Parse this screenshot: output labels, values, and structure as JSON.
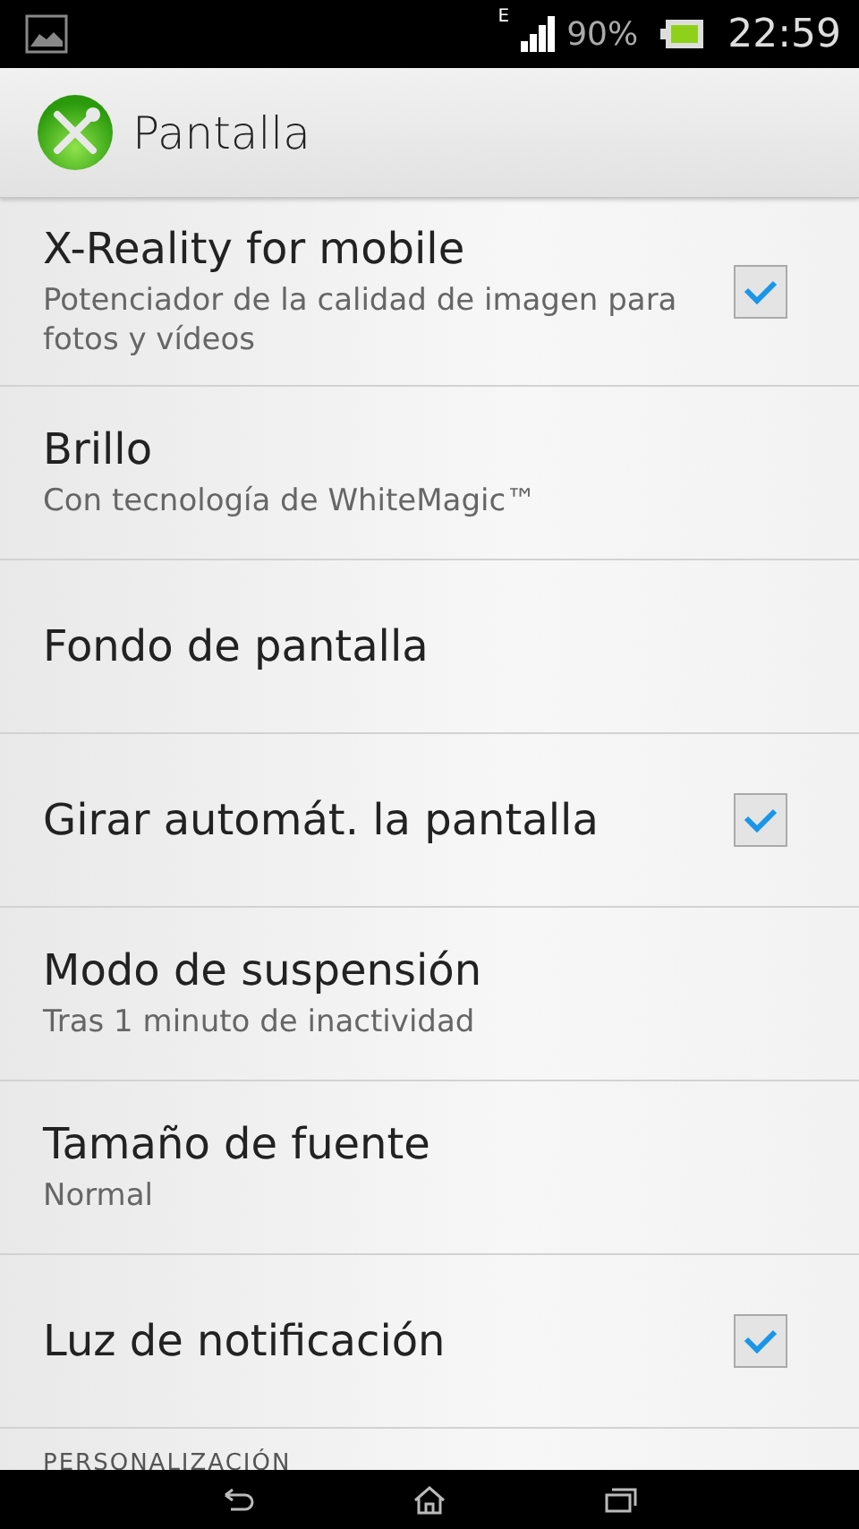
{
  "status_bar": {
    "network": "E",
    "battery_percent": "90%",
    "time": "22:59"
  },
  "action_bar": {
    "title": "Pantalla"
  },
  "settings": [
    {
      "kind": "checkbox",
      "title": "X-Reality for mobile",
      "summary": "Potenciador de la calidad de imagen para fotos y vídeos",
      "checked": true
    },
    {
      "kind": "plain",
      "title": "Brillo",
      "summary": "Con tecnología de WhiteMagic™"
    },
    {
      "kind": "plain",
      "title": "Fondo de pantalla"
    },
    {
      "kind": "checkbox",
      "title": "Girar automát. la pantalla",
      "checked": true
    },
    {
      "kind": "plain",
      "title": "Modo de suspensión",
      "summary": "Tras 1 minuto de inactividad"
    },
    {
      "kind": "plain",
      "title": "Tamaño de fuente",
      "summary": "Normal"
    },
    {
      "kind": "checkbox",
      "title": "Luz de notificación",
      "checked": true
    }
  ],
  "section_header": "PERSONALIZACIÓN"
}
